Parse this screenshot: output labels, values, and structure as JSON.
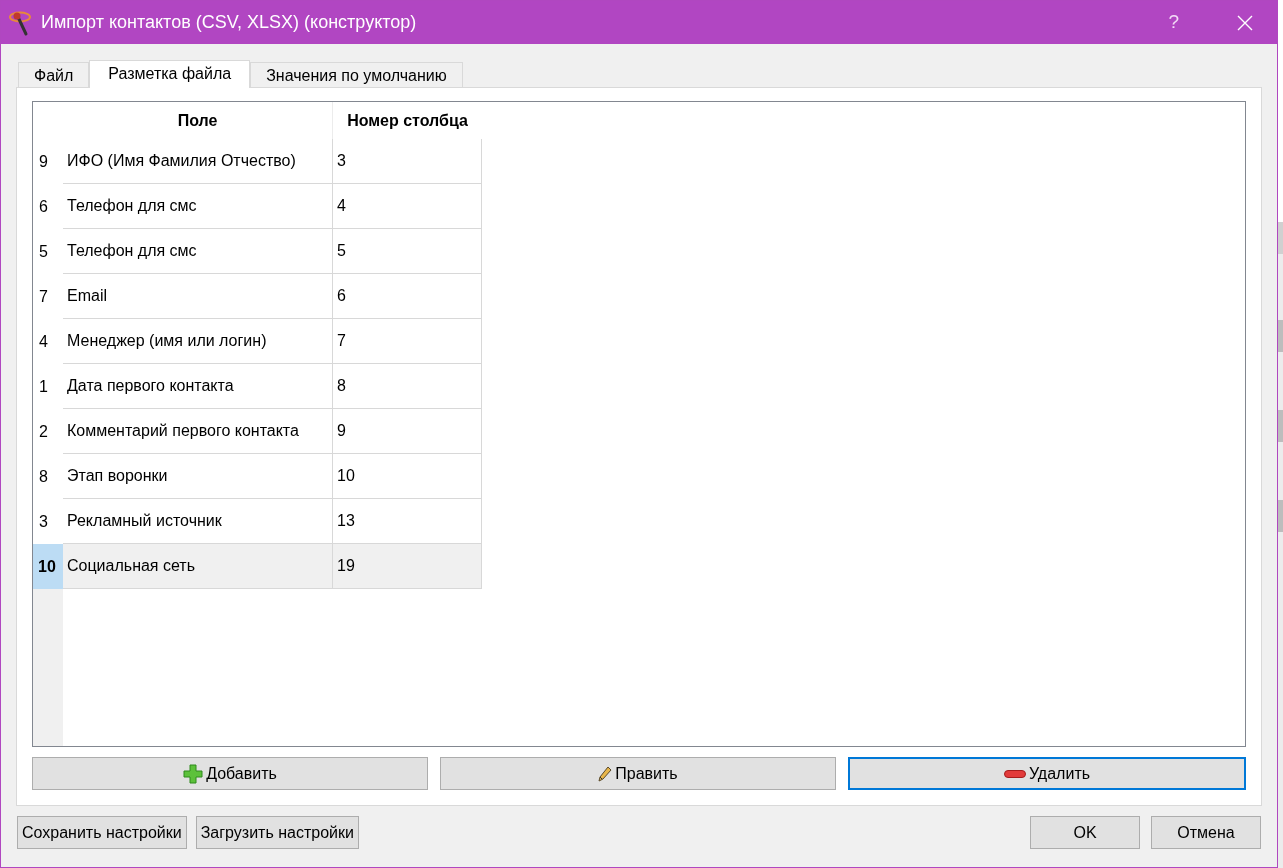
{
  "window": {
    "title": "Импорт контактов (CSV, XLSX) (конструктор)",
    "help": "?"
  },
  "tabs": [
    {
      "label": "Файл",
      "selected": false
    },
    {
      "label": "Разметка файла",
      "selected": true
    },
    {
      "label": "Значения по умолчанию",
      "selected": false
    }
  ],
  "table": {
    "columns": [
      "Поле",
      "Номер столбца"
    ],
    "rows": [
      {
        "number": "9",
        "field": "ИФО (Имя Фамилия Отчество)",
        "column": "3",
        "selected": false
      },
      {
        "number": "6",
        "field": "Телефон для смс",
        "column": "4",
        "selected": false
      },
      {
        "number": "5",
        "field": "Телефон для смс",
        "column": "5",
        "selected": false
      },
      {
        "number": "7",
        "field": "Email",
        "column": "6",
        "selected": false
      },
      {
        "number": "4",
        "field": "Менеджер (имя или логин)",
        "column": "7",
        "selected": false
      },
      {
        "number": "1",
        "field": "Дата первого контакта",
        "column": "8",
        "selected": false
      },
      {
        "number": "2",
        "field": "Комментарий первого контакта",
        "column": "9",
        "selected": false
      },
      {
        "number": "8",
        "field": "Этап воронки",
        "column": "10",
        "selected": false
      },
      {
        "number": "3",
        "field": "Рекламный источник",
        "column": "13",
        "selected": false
      },
      {
        "number": "10",
        "field": "Социальная сеть",
        "column": "19",
        "selected": true
      }
    ]
  },
  "actions": [
    {
      "kind": "add",
      "label": "Добавить",
      "focused": false
    },
    {
      "kind": "edit",
      "label": "Править",
      "focused": false
    },
    {
      "kind": "delete",
      "label": "Удалить",
      "focused": true
    }
  ],
  "footer": {
    "left": [
      "Сохранить настройки",
      "Загрузить настройки"
    ],
    "right": [
      "OK",
      "Отмена"
    ]
  }
}
